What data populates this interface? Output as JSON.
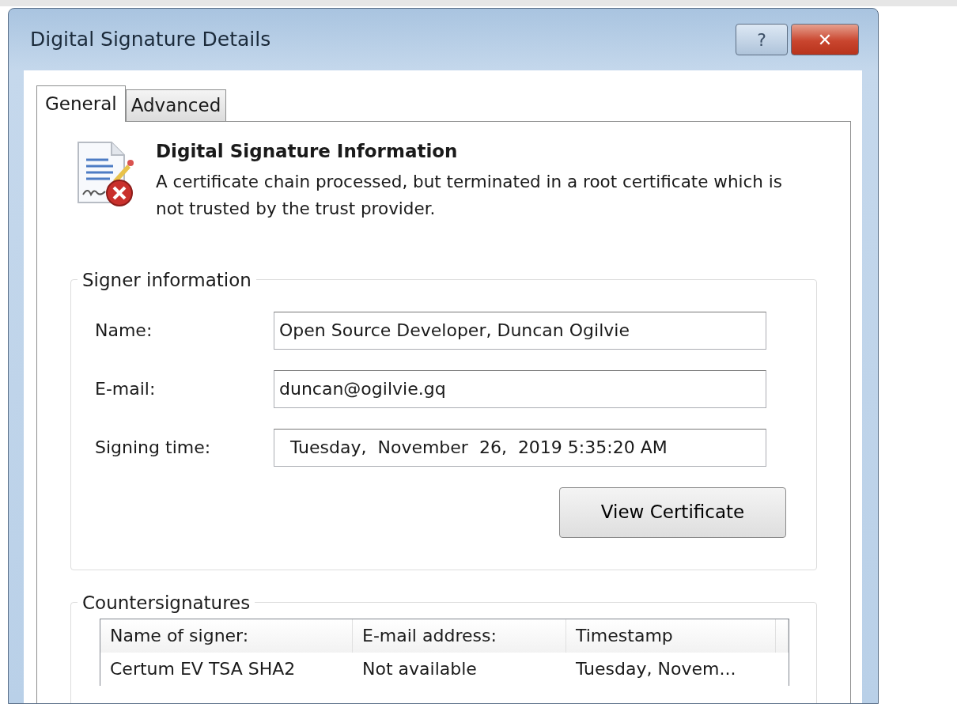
{
  "window": {
    "title": "Digital Signature Details",
    "help_button": "?",
    "close_button": "✕"
  },
  "tabs": [
    {
      "label": "General",
      "selected": true
    },
    {
      "label": "Advanced",
      "selected": false
    }
  ],
  "info": {
    "heading": "Digital Signature Information",
    "message": "A certificate chain processed, but terminated in a root certificate which is not trusted by the trust provider."
  },
  "signer": {
    "title": "Signer information",
    "fields": [
      {
        "label": "Name:",
        "value": "Open Source Developer, Duncan Ogilvie"
      },
      {
        "label": "E-mail:",
        "value": "duncan@ogilvie.gq"
      },
      {
        "label": "Signing time:",
        "value": "  Tuesday,  November  26,  2019 5:35:20 AM"
      }
    ],
    "button": "View Certificate"
  },
  "countersignatures": {
    "title": "Countersignatures",
    "columns": [
      "Name of signer:",
      "E-mail address:",
      "Timestamp"
    ],
    "rows": [
      [
        "Certum EV TSA SHA2",
        "Not available",
        "Tuesday, Novem..."
      ]
    ]
  }
}
